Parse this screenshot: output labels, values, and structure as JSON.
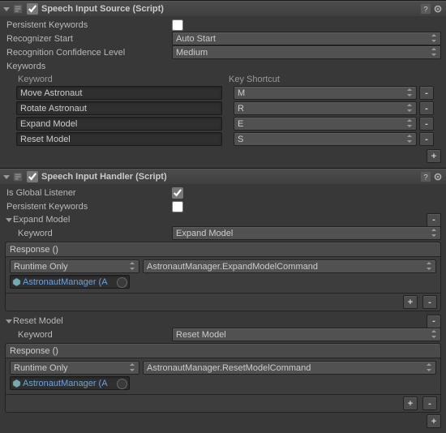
{
  "speech_source": {
    "title": "Speech Input Source (Script)",
    "persistent_keywords_label": "Persistent Keywords",
    "recognizer_start_label": "Recognizer Start",
    "recognizer_start_value": "Auto Start",
    "conf_label": "Recognition Confidence Level",
    "conf_value": "Medium",
    "keywords_label": "Keywords",
    "col_keyword": "Keyword",
    "col_shortcut": "Key Shortcut",
    "items": [
      {
        "kw": "Move Astronaut",
        "sc": "M"
      },
      {
        "kw": "Rotate Astronaut",
        "sc": "R"
      },
      {
        "kw": "Expand Model",
        "sc": "E"
      },
      {
        "kw": "Reset Model",
        "sc": "S"
      }
    ]
  },
  "speech_handler": {
    "title": "Speech Input Handler (Script)",
    "global_label": "Is Global Listener",
    "global_value": true,
    "persistent_keywords_label": "Persistent Keywords",
    "sections": [
      {
        "fold_label": "Expand Model",
        "keyword_label": "Keyword",
        "keyword_value": "Expand Model",
        "response_label": "Response ()",
        "mode": "Runtime Only",
        "fn": "AstronautManager.ExpandModelCommand",
        "obj": "AstronautManager (A"
      },
      {
        "fold_label": "Reset Model",
        "keyword_label": "Keyword",
        "keyword_value": "Reset Model",
        "response_label": "Response ()",
        "mode": "Runtime Only",
        "fn": "AstronautManager.ResetModelCommand",
        "obj": "AstronautManager (A"
      }
    ]
  },
  "glyph": {
    "plus": "+",
    "minus": "-"
  }
}
